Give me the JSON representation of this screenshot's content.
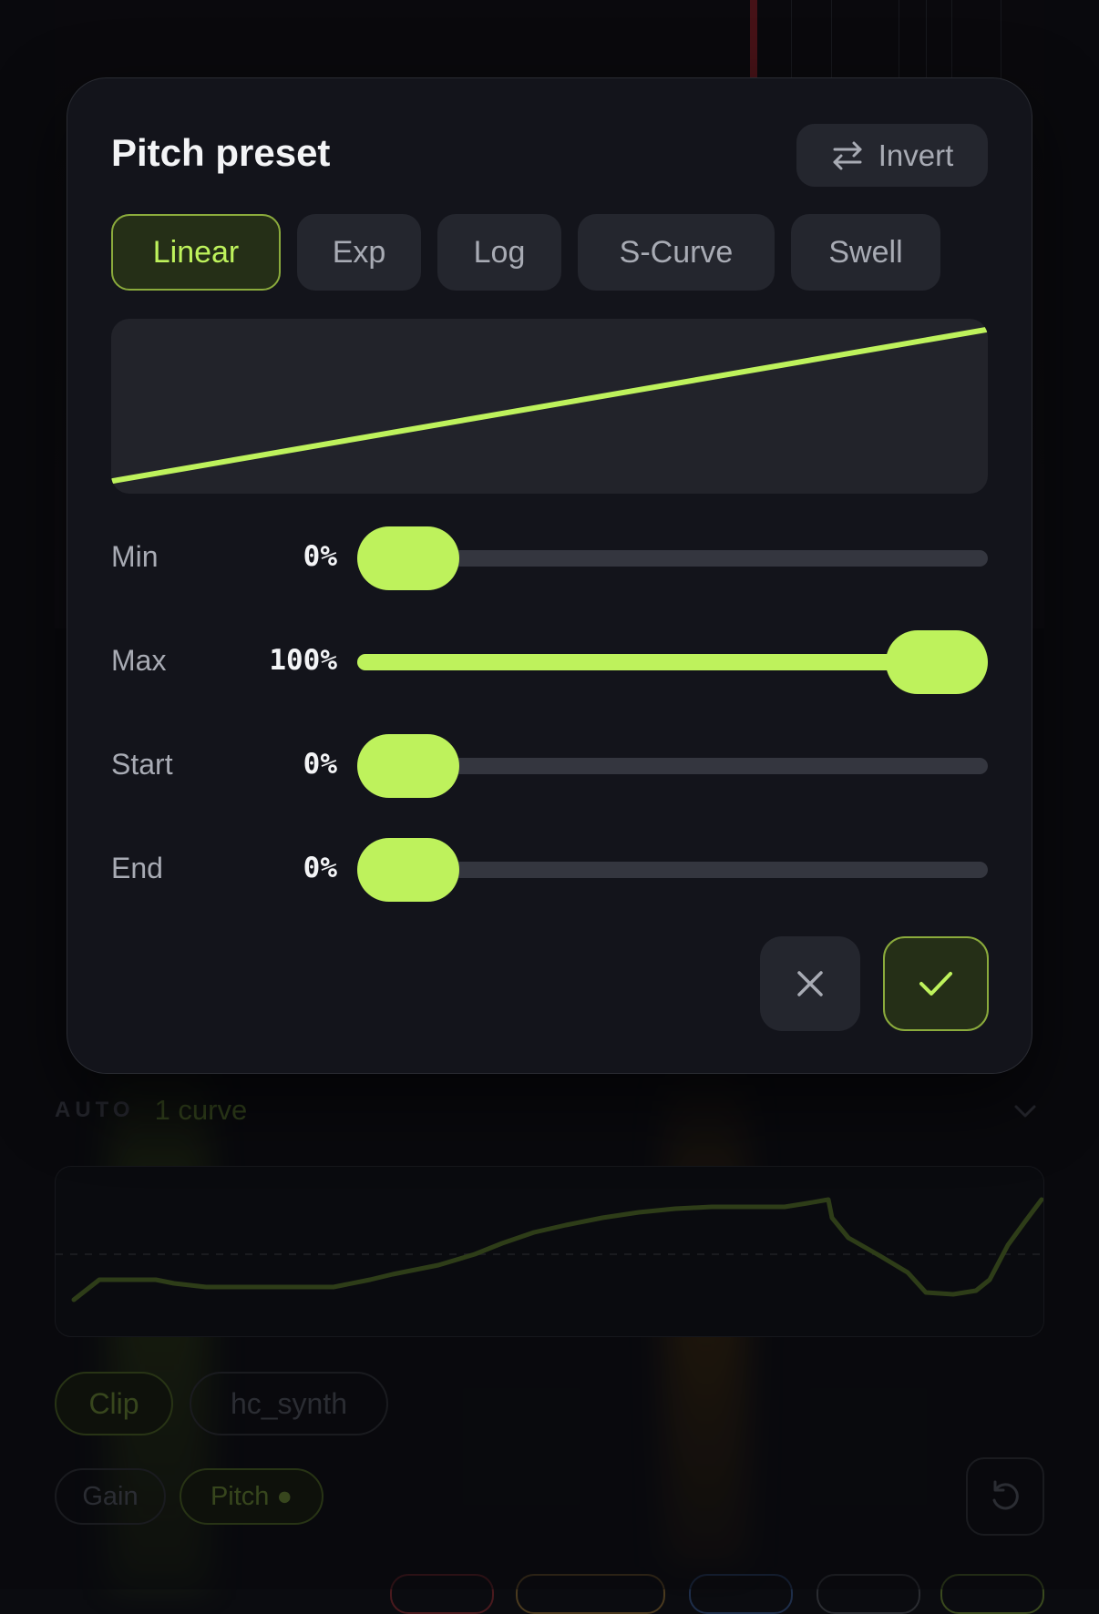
{
  "modal": {
    "title": "Pitch preset",
    "invert_label": "Invert",
    "tabs": [
      {
        "label": "Linear",
        "active": true
      },
      {
        "label": "Exp",
        "active": false
      },
      {
        "label": "Log",
        "active": false
      },
      {
        "label": "S-Curve",
        "active": false
      },
      {
        "label": "Swell",
        "active": false
      }
    ],
    "sliders": [
      {
        "label": "Min",
        "value": "0%",
        "level": 0
      },
      {
        "label": "Max",
        "value": "100%",
        "level": 1
      },
      {
        "label": "Start",
        "value": "0%",
        "level": 0
      },
      {
        "label": "End",
        "value": "0%",
        "level": 0
      }
    ],
    "icons": {
      "invert": "swap-arrows-icon",
      "cancel": "close-icon",
      "confirm": "checkmark-icon"
    },
    "accent_color": "#bef25c"
  },
  "background": {
    "auto_label": "AUTO",
    "curve_count": "1 curve",
    "chips": [
      "Clip",
      "hc_synth"
    ],
    "params": [
      "Gain",
      "Pitch ●"
    ],
    "icons": {
      "collapse": "chevron-down-icon",
      "reset": "reset-icon"
    }
  }
}
